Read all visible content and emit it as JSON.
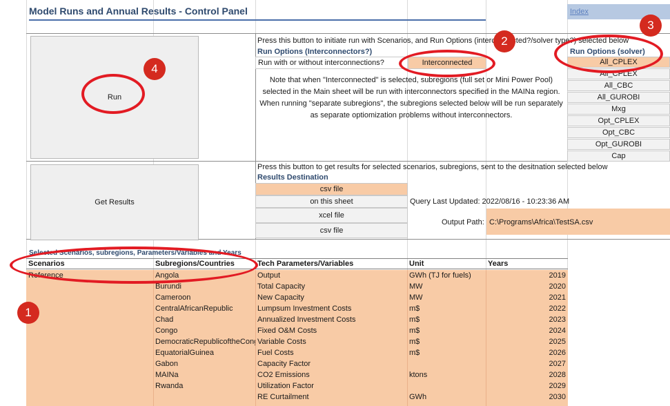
{
  "title": "Model Runs and Annual Results - Control Panel",
  "index_link": "Index",
  "run_section": {
    "run_button": "Run",
    "instruction": "Press this button to initiate run with Scenarios, and Run Options (interconnected?/solver type?) selected below",
    "options_header": "Run Options (Interconnectors?)",
    "interconnect_question": "Run with or without interconnections?",
    "interconnect_value": "Interconnected",
    "note_lines": [
      "Note that when \"Interconnected\" is selected, subregions (full set or Mini Power Pool)",
      "selected in the Main sheet will be run with interconnectors specified in the MAINa region.",
      "When running \"separate subregions\", the subregions selected below will be run separately",
      "as separate optiomization problems without interconnectors."
    ],
    "solver_header": "Run Options (solver)",
    "solvers": [
      "All_CPLEX",
      "All_CPLEX",
      "All_CBC",
      "All_GUROBI",
      "Mxg",
      "Opt_CPLEX",
      "Opt_CBC",
      "Opt_GUROBI",
      "Cap"
    ]
  },
  "results_section": {
    "get_results_button": "Get Results",
    "instruction": "Press this button to get results for selected scenarios, subregions, sent to the desitnation selected below",
    "destination_header": "Results Destination",
    "destinations": [
      "csv file",
      "on this sheet",
      "xcel file",
      "csv file"
    ],
    "query_updated": "Query Last Updated: 2022/08/16 - 10:23:36 AM",
    "output_path_label": "Output Path:",
    "output_path_value": "C:\\Programs\\Africa\\TestSA.csv"
  },
  "selection_table": {
    "caption": "Selected Scenarios, subregions, Parameters/Variables and Years",
    "headers": [
      "Scenarios",
      "Subregions/Countries",
      "Tech Parameters/Variables",
      "Unit",
      "Years"
    ],
    "scenarios": [
      "Reference"
    ],
    "subregions": [
      "Angola",
      "Burundi",
      "Cameroon",
      "CentralAfricanRepublic",
      "Chad",
      "Congo",
      "DemocraticRepublicoftheCongo",
      "EquatorialGuinea",
      "Gabon",
      "MAINa",
      "Rwanda"
    ],
    "parameters": [
      "Output",
      "Total Capacity",
      "New Capacity",
      "Lumpsum Investment Costs",
      "Annualized Investment Costs",
      "Fixed O&M Costs",
      "Variable Costs",
      "Fuel Costs",
      "Capacity Factor",
      "CO2 Emissions",
      "Utilization Factor",
      "RE Curtailment"
    ],
    "units": [
      "GWh (TJ for fuels)",
      "MW",
      "MW",
      "m$",
      "m$",
      "m$",
      "m$",
      "m$",
      "",
      "ktons",
      "",
      "GWh"
    ],
    "years": [
      "2019",
      "2020",
      "2021",
      "2022",
      "2023",
      "2024",
      "2025",
      "2026",
      "2027",
      "2028",
      "2029",
      "2030"
    ]
  },
  "annotation_badges": [
    "1",
    "2",
    "3",
    "4"
  ],
  "colors": {
    "orange_cell": "#f8cba6",
    "header_blue": "#2f4a6e",
    "annotation_red": "#e21b23"
  }
}
